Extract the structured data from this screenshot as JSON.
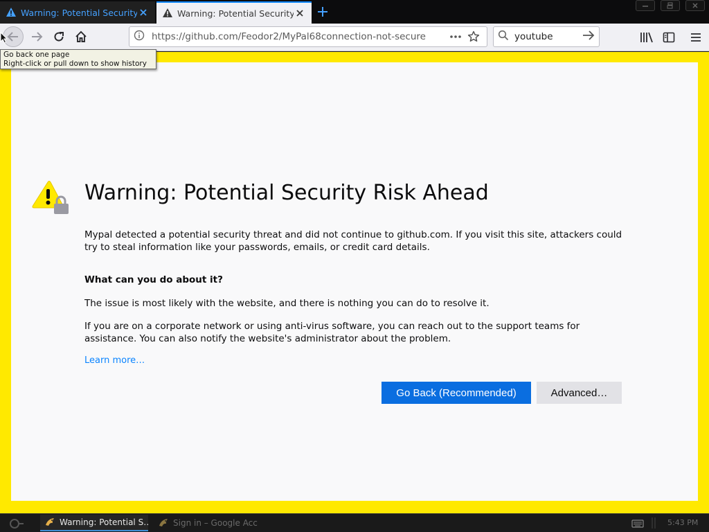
{
  "browser": {
    "tabs": [
      {
        "title": "Warning: Potential Security R",
        "active": false
      },
      {
        "title": "Warning: Potential Security R",
        "active": true
      }
    ],
    "url": "https://github.com/Feodor2/MyPal68connection-not-secure",
    "search_value": "youtube"
  },
  "tooltip": {
    "line1": "Go back one page",
    "line2": "Right-click or pull down to show history"
  },
  "page": {
    "title": "Warning: Potential Security Risk Ahead",
    "intro": "Mypal detected a potential security threat and did not continue to github.com. If you visit this site, attackers could try to steal information like your passwords, emails, or credit card details.",
    "what_heading": "What can you do about it?",
    "issue_text": "The issue is most likely with the website, and there is nothing you can do to resolve it.",
    "corporate_text": "If you are on a corporate network or using anti-virus software, you can reach out to the support teams for assistance. You can also notify the website's administrator about the problem.",
    "learn_more": "Learn more…",
    "go_back_label": "Go Back (Recommended)",
    "advanced_label": "Advanced…"
  },
  "taskbar": {
    "tasks": [
      {
        "label": "Warning: Potential S…",
        "active": true
      },
      {
        "label": "Sign in – Google Acc…",
        "active": false
      }
    ],
    "clock": "5:43 PM"
  },
  "colors": {
    "accent": "#0a84ff",
    "warning_border": "#ffe900",
    "primary_button": "#0a6ee0"
  }
}
